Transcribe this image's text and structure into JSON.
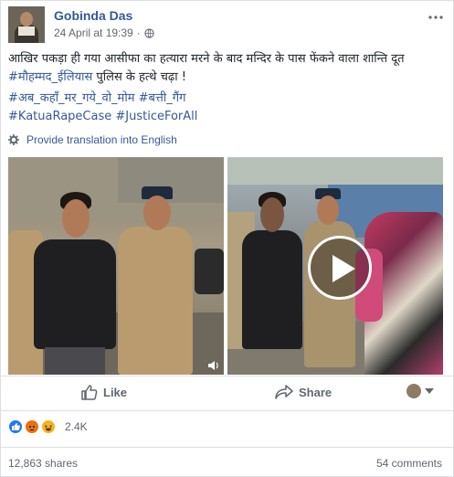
{
  "post": {
    "author": "Gobinda Das",
    "timestamp": "24 April at 19:39",
    "separator": "·",
    "privacy_icon": "globe-icon",
    "more_icon": "ellipsis-icon",
    "text_part1": "आखिर पकड़ा ही गया आसीफा का हत्यारा मरने के बाद मन्दिर के पास फेंकने वाला शान्ति दूत ",
    "text_mention": "#मौहम्मद_ईलियास",
    "text_part2": " पुलिस के हत्थे चढ़ा !",
    "hashtags_line1": "#अब_कहाँ_मर_गये_वो_मोम #बत्ती_गैंग",
    "hashtags_line2": "#KatuaRapeCase #JusticeForAll",
    "translate_label": "Provide translation into English"
  },
  "actions": {
    "like_label": "Like",
    "share_label": "Share"
  },
  "stats": {
    "reactions_count": "2.4K",
    "shares": "12,863 shares",
    "comments": "54 comments"
  },
  "colors": {
    "link": "#365899",
    "like_blue": "#2078f4",
    "angry": "#e9710f",
    "haha": "#f7b125"
  }
}
